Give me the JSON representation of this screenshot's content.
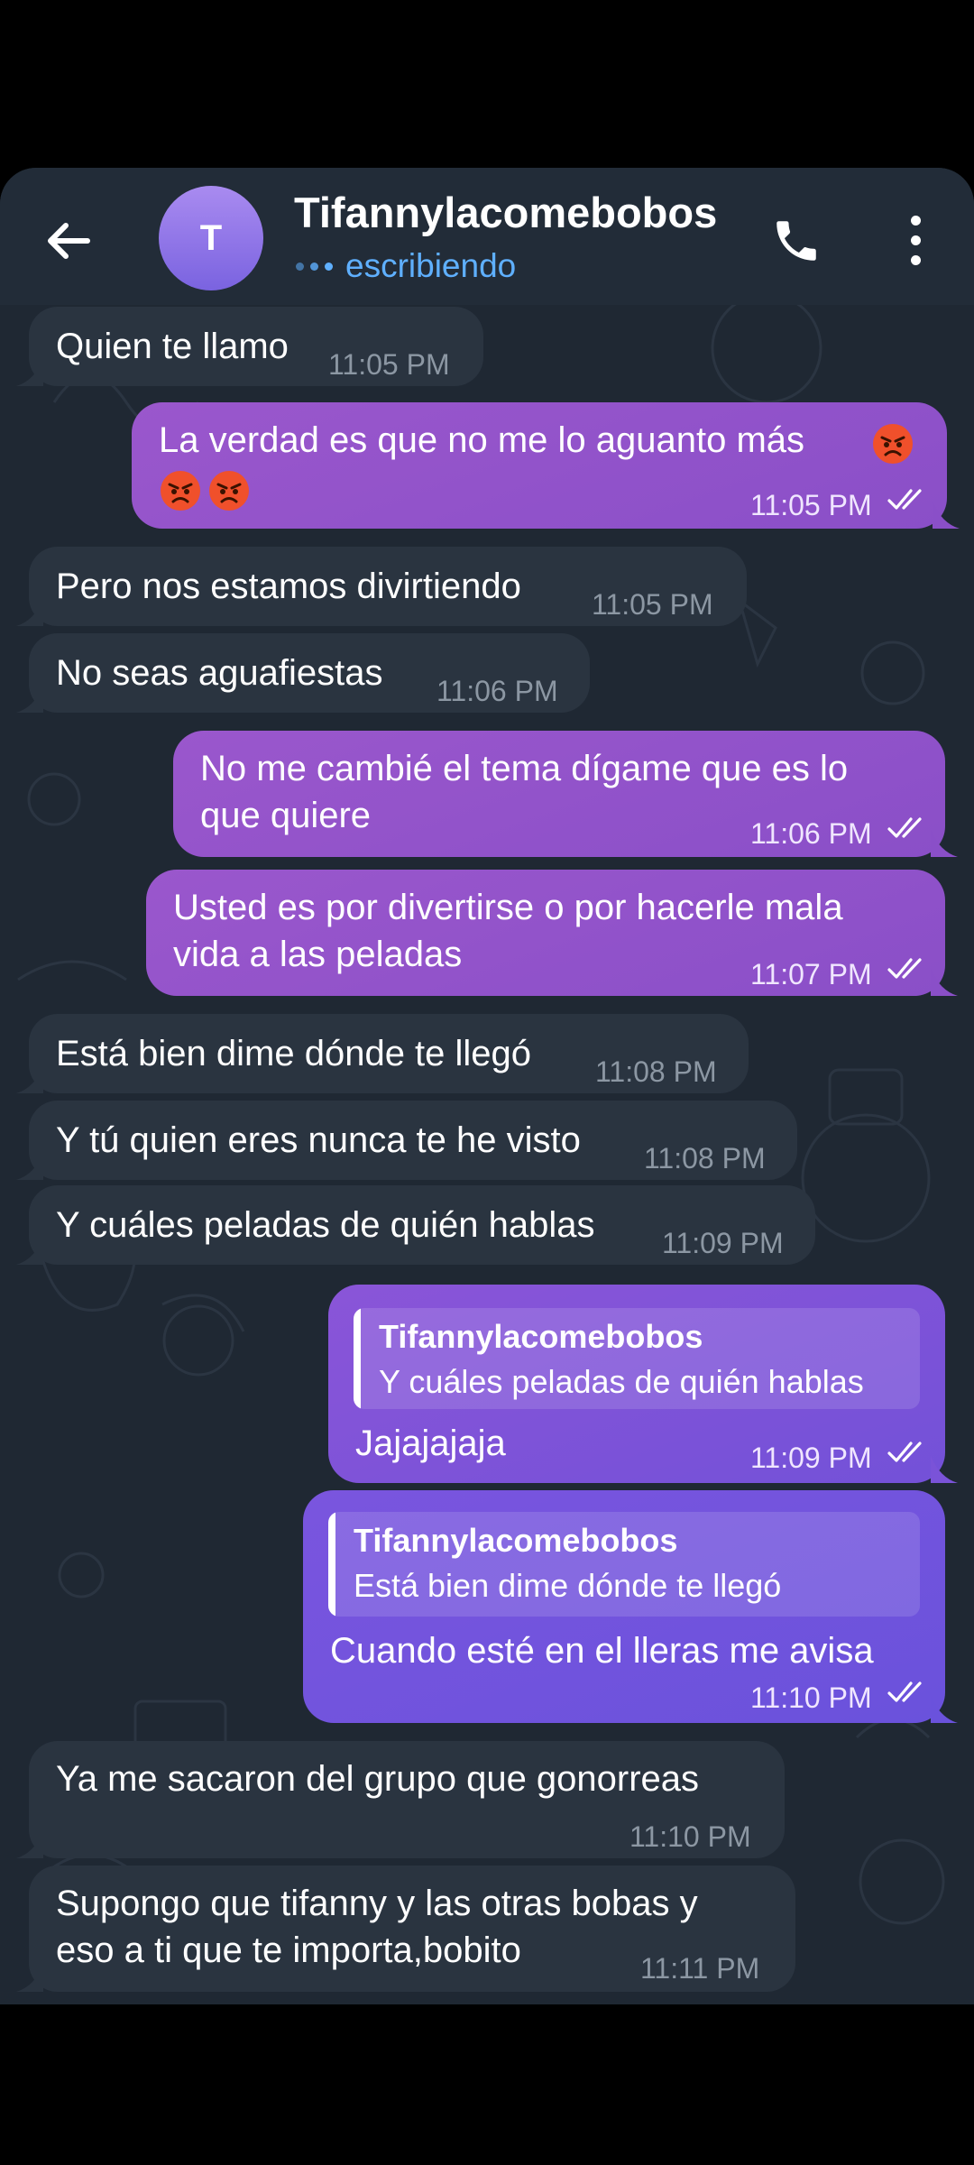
{
  "header": {
    "avatar_letter": "T",
    "contact_name": "Tifannylacomebobos",
    "status": "escribiendo",
    "back_icon": "arrow-left-icon",
    "call_icon": "phone-icon",
    "menu_icon": "more-vertical-icon"
  },
  "messages": [
    {
      "dir": "in",
      "text": "Quien te llamo",
      "time": "11:05 PM"
    },
    {
      "dir": "out",
      "text": "La verdad es que no me lo aguanto más",
      "emojis": [
        "angry-face",
        "angry-face",
        "angry-face"
      ],
      "time": "11:05 PM",
      "read": true
    },
    {
      "dir": "in",
      "text": "Pero nos estamos divirtiendo",
      "time": "11:05 PM"
    },
    {
      "dir": "in",
      "text": "No seas aguafiestas",
      "time": "11:06 PM"
    },
    {
      "dir": "out",
      "text": "No me cambié el tema dígame que es lo\nque quiere",
      "time": "11:06 PM",
      "read": true
    },
    {
      "dir": "out",
      "text": "Usted es por divertirse o por hacerle mala\nvida a las peladas",
      "time": "11:07 PM",
      "read": true
    },
    {
      "dir": "in",
      "text": "Está bien dime dónde te llegó",
      "time": "11:08 PM"
    },
    {
      "dir": "in",
      "text": "Y tú quien eres nunca te he visto",
      "time": "11:08 PM"
    },
    {
      "dir": "in",
      "text": "Y cuáles peladas de quién hablas",
      "time": "11:09 PM"
    },
    {
      "dir": "out",
      "reply_name": "Tifannylacomebobos",
      "reply_text": "Y cuáles peladas de quién hablas",
      "text": "Jajajajaja",
      "time": "11:09 PM",
      "read": true
    },
    {
      "dir": "out",
      "reply_name": "Tifannylacomebobos",
      "reply_text": "Está bien dime dónde te llegó",
      "text": "Cuando esté en el lleras me avisa",
      "time": "11:10 PM",
      "read": true
    },
    {
      "dir": "in",
      "text": "Ya me sacaron del grupo que gonorreas",
      "time": "11:10 PM"
    },
    {
      "dir": "in",
      "text": "Supongo que tifanny y las otras bobas y\neso a ti que te importa,bobito",
      "time": "11:11 PM"
    }
  ],
  "colors": {
    "chat_bg": "#1f2833",
    "header_bg": "#222c38",
    "incoming_bubble": "#2a3440",
    "outgoing_bubble": "#9a57cc",
    "status_accent": "#5fb0ff"
  }
}
